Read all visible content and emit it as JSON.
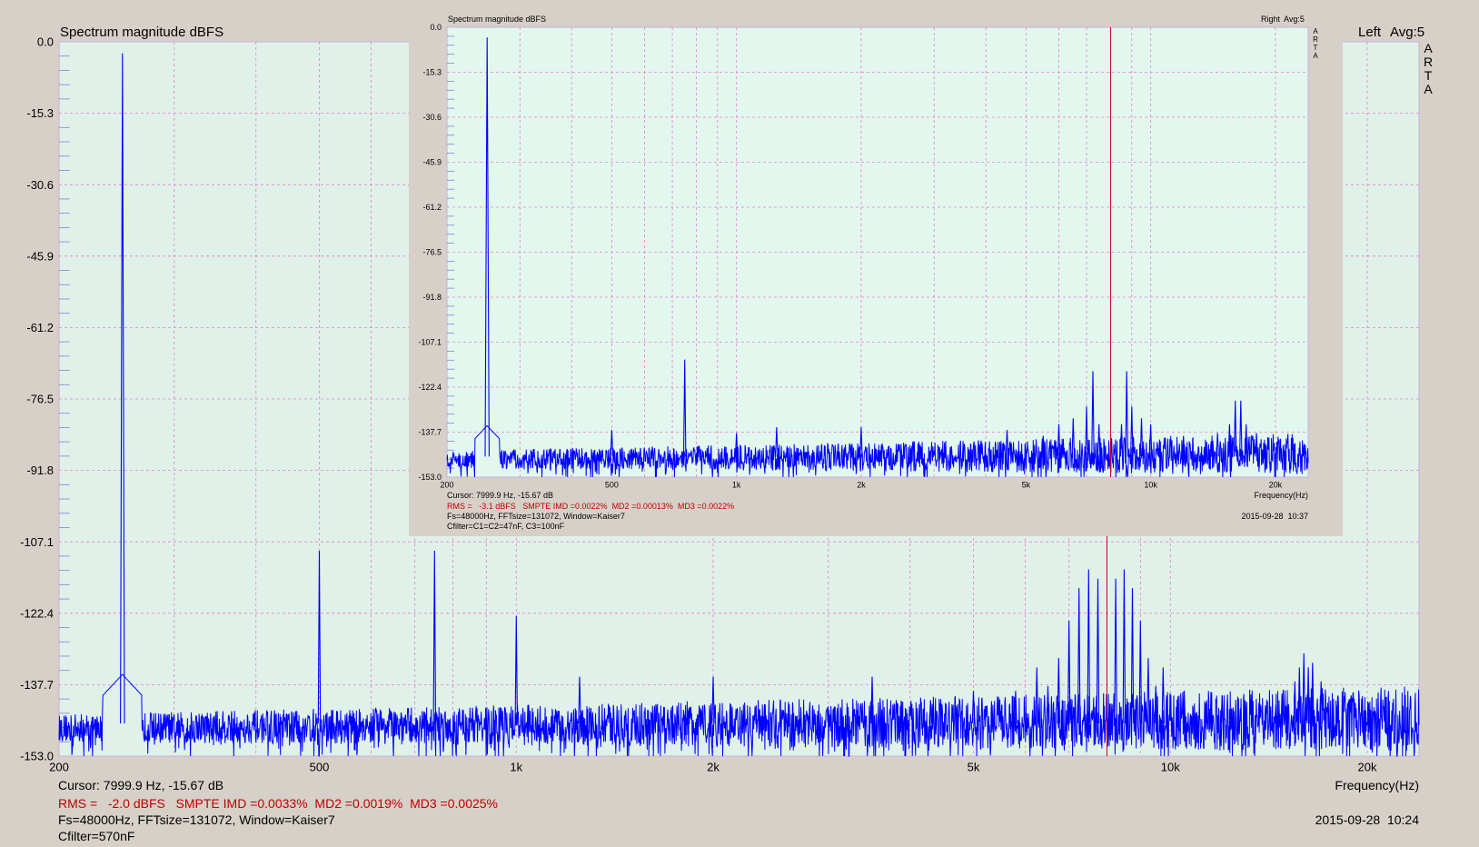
{
  "chart_data": [
    {
      "type": "line",
      "title": "Spectrum magnitude dBFS",
      "channel_label": "Left",
      "avg_label": "Avg:5",
      "brand_letters": [
        "A",
        "R",
        "T",
        "A"
      ],
      "xlabel": "Frequency(Hz)",
      "x_scale": "log",
      "xlim": [
        200,
        24000
      ],
      "ylim": [
        -153.0,
        0.0
      ],
      "y_ticks": [
        "0.0",
        "-15.3",
        "-30.6",
        "-45.9",
        "-61.2",
        "-76.5",
        "-91.8",
        "-107.1",
        "-122.4",
        "-137.7",
        "-153.0"
      ],
      "x_ticks": [
        {
          "value": 200,
          "label": "200"
        },
        {
          "value": 500,
          "label": "500"
        },
        {
          "value": 1000,
          "label": "1k"
        },
        {
          "value": 2000,
          "label": "2k"
        },
        {
          "value": 5000,
          "label": "5k"
        },
        {
          "value": 10000,
          "label": "10k"
        },
        {
          "value": 20000,
          "label": "20k"
        }
      ],
      "cursor_freq": 7999.9,
      "noise_floor": {
        "low_start": -147,
        "high_end": -145
      },
      "peaks": [
        {
          "f": 250,
          "db": -2.5
        },
        {
          "f": 500,
          "db": -109
        },
        {
          "f": 750,
          "db": -109
        },
        {
          "f": 1000,
          "db": -123
        },
        {
          "f": 1250,
          "db": -136
        },
        {
          "f": 2000,
          "db": -136
        },
        {
          "f": 3500,
          "db": -136
        },
        {
          "f": 4300,
          "db": -141
        },
        {
          "f": 5000,
          "db": -139
        },
        {
          "f": 5800,
          "db": -139
        },
        {
          "f": 6250,
          "db": -134
        },
        {
          "f": 6500,
          "db": -138
        },
        {
          "f": 6750,
          "db": -132
        },
        {
          "f": 7000,
          "db": -124
        },
        {
          "f": 7250,
          "db": -117
        },
        {
          "f": 7500,
          "db": -113
        },
        {
          "f": 7750,
          "db": -115
        },
        {
          "f": 8250,
          "db": -115
        },
        {
          "f": 8500,
          "db": -113
        },
        {
          "f": 8750,
          "db": -117
        },
        {
          "f": 9000,
          "db": -124
        },
        {
          "f": 9250,
          "db": -132
        },
        {
          "f": 9500,
          "db": -138
        },
        {
          "f": 9750,
          "db": -134
        },
        {
          "f": 10500,
          "db": -139
        },
        {
          "f": 12000,
          "db": -140
        },
        {
          "f": 13000,
          "db": -141
        },
        {
          "f": 14500,
          "db": -142
        },
        {
          "f": 15500,
          "db": -137
        },
        {
          "f": 15750,
          "db": -134
        },
        {
          "f": 16000,
          "db": -131
        },
        {
          "f": 16250,
          "db": -134
        },
        {
          "f": 16500,
          "db": -133
        },
        {
          "f": 17000,
          "db": -137
        },
        {
          "f": 18000,
          "db": -142
        }
      ],
      "cursor": "Cursor:  7999.9 Hz, -15.67 dB",
      "rms": "RMS =   -2.0 dBFS   SMPTE IMD =0.0033%  MD2 =0.0019%  MD3 =0.0025%",
      "settings": "Fs=48000Hz, FFTsize=131072, Window=Kaiser7",
      "filter": "Cfilter=570nF",
      "timestamp": "2015-09-28  10:24",
      "colors": {
        "plot_bg": "#dff1e8",
        "trace": "#0000ff",
        "grid": "#e87fcf",
        "cursor": "#c4002a",
        "frame": "#d6d0c8"
      }
    },
    {
      "type": "line",
      "title": "Spectrum magnitude dBFS",
      "channel_label": "Right",
      "avg_label": "Avg:5",
      "brand_letters": [
        "A",
        "R",
        "T",
        "A"
      ],
      "xlabel": "Frequency(Hz)",
      "x_scale": "log",
      "xlim": [
        200,
        24000
      ],
      "ylim": [
        -153.0,
        0.0
      ],
      "y_ticks": [
        "0.0",
        "-15.3",
        "-30.6",
        "-45.9",
        "-61.2",
        "-76.5",
        "-91.8",
        "-107.1",
        "-122.4",
        "-137.7",
        "-153.0"
      ],
      "x_ticks": [
        {
          "value": 200,
          "label": "200"
        },
        {
          "value": 500,
          "label": "500"
        },
        {
          "value": 1000,
          "label": "1k"
        },
        {
          "value": 2000,
          "label": "2k"
        },
        {
          "value": 5000,
          "label": "5k"
        },
        {
          "value": 10000,
          "label": "10k"
        },
        {
          "value": 20000,
          "label": "20k"
        }
      ],
      "cursor_freq": 7999.9,
      "noise_floor": {
        "low_start": -147,
        "high_end": -145
      },
      "peaks": [
        {
          "f": 250,
          "db": -3.5
        },
        {
          "f": 500,
          "db": -137
        },
        {
          "f": 750,
          "db": -113
        },
        {
          "f": 1000,
          "db": -138
        },
        {
          "f": 1250,
          "db": -136
        },
        {
          "f": 2000,
          "db": -136
        },
        {
          "f": 4500,
          "db": -137
        },
        {
          "f": 5500,
          "db": -139
        },
        {
          "f": 6000,
          "db": -135
        },
        {
          "f": 6500,
          "db": -133
        },
        {
          "f": 7000,
          "db": -129
        },
        {
          "f": 7250,
          "db": -117
        },
        {
          "f": 7500,
          "db": -135
        },
        {
          "f": 8500,
          "db": -135
        },
        {
          "f": 8750,
          "db": -117
        },
        {
          "f": 9000,
          "db": -129
        },
        {
          "f": 9500,
          "db": -133
        },
        {
          "f": 10000,
          "db": -135
        },
        {
          "f": 12000,
          "db": -139
        },
        {
          "f": 14500,
          "db": -138
        },
        {
          "f": 15500,
          "db": -135
        },
        {
          "f": 16000,
          "db": -127
        },
        {
          "f": 16500,
          "db": -127
        },
        {
          "f": 17000,
          "db": -135
        },
        {
          "f": 18000,
          "db": -138
        }
      ],
      "cursor": "Cursor:  7999.9 Hz, -15.67 dB",
      "rms": "RMS =   -3.1 dBFS   SMPTE IMD =0.0022%  MD2 =0.00013%  MD3 =0.0022%",
      "settings": "Fs=48000Hz, FFTsize=131072, Window=Kaiser7",
      "filter": "Cfilter=C1=C2=47nF, C3=100nF",
      "timestamp": "2015-09-28  10:37",
      "colors": {
        "plot_bg": "#e2f7ee",
        "trace": "#0000ff",
        "grid": "#e87fcf",
        "cursor": "#c4002a",
        "frame": "#d6d0c8"
      }
    }
  ]
}
